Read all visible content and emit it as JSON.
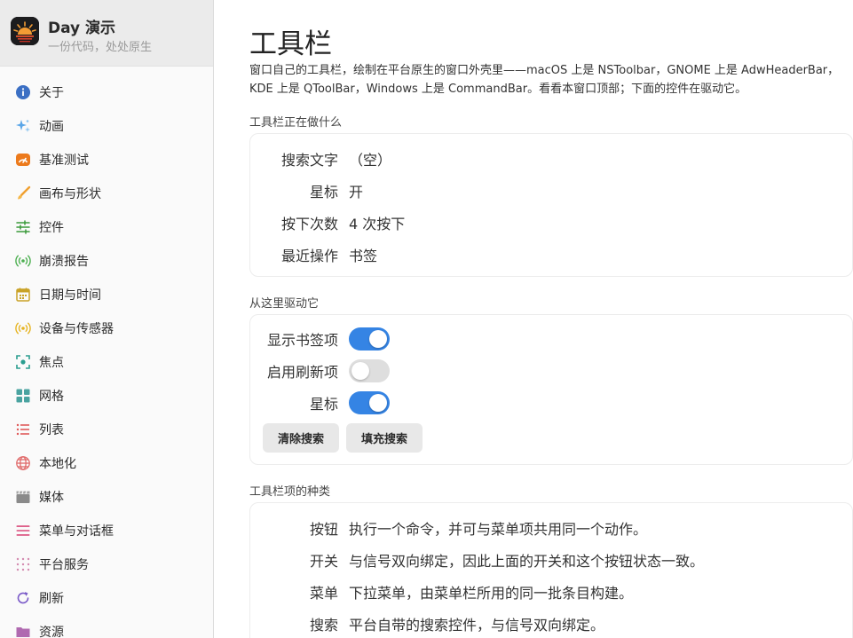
{
  "sidebar": {
    "app_title": "Day 演示",
    "app_subtitle": "一份代码，处处原生",
    "items": [
      {
        "label": "关于",
        "icon": "info-icon",
        "color": "#3b6fc4"
      },
      {
        "label": "动画",
        "icon": "sparkle-icon",
        "color": "#5aa6e8"
      },
      {
        "label": "基准测试",
        "icon": "speedometer-icon",
        "color": "#ec7a1c"
      },
      {
        "label": "画布与形状",
        "icon": "brush-icon",
        "color": "#f0a030"
      },
      {
        "label": "控件",
        "icon": "sliders-icon",
        "color": "#3a9a3a"
      },
      {
        "label": "崩溃报告",
        "icon": "broadcast-icon",
        "color": "#4caf50"
      },
      {
        "label": "日期与时间",
        "icon": "calendar-icon",
        "color": "#c9a227"
      },
      {
        "label": "设备与传感器",
        "icon": "sensor-icon",
        "color": "#e6b422"
      },
      {
        "label": "焦点",
        "icon": "focus-icon",
        "color": "#2a9d8f"
      },
      {
        "label": "网格",
        "icon": "grid-icon",
        "color": "#4aa3a0"
      },
      {
        "label": "列表",
        "icon": "list-icon",
        "color": "#e05a5a"
      },
      {
        "label": "本地化",
        "icon": "globe-icon",
        "color": "#e06a6a"
      },
      {
        "label": "媒体",
        "icon": "clapper-icon",
        "color": "#8a8a8a"
      },
      {
        "label": "菜单与对话框",
        "icon": "menu-icon",
        "color": "#d94a7a"
      },
      {
        "label": "平台服务",
        "icon": "dots-grid-icon",
        "color": "#d48ab0"
      },
      {
        "label": "刷新",
        "icon": "refresh-icon",
        "color": "#7a5ac8"
      },
      {
        "label": "资源",
        "icon": "folder-icon",
        "color": "#b06ab0"
      }
    ]
  },
  "main": {
    "title": "工具栏",
    "description": "窗口自己的工具栏，绘制在平台原生的窗口外壳里——macOS 上是 NSToolbar，GNOME 上是 AdwHeaderBar，KDE 上是 QToolBar，Windows 上是 CommandBar。看看本窗口顶部；下面的控件在驱动它。",
    "status_section": {
      "title": "工具栏正在做什么",
      "rows": [
        {
          "key": "搜索文字",
          "value": "（空）"
        },
        {
          "key": "星标",
          "value": "开"
        },
        {
          "key": "按下次数",
          "value": "4 次按下"
        },
        {
          "key": "最近操作",
          "value": "书签"
        }
      ]
    },
    "drive_section": {
      "title": "从这里驱动它",
      "toggles": [
        {
          "label": "显示书签项",
          "on": true
        },
        {
          "label": "启用刷新项",
          "on": false
        },
        {
          "label": "星标",
          "on": true
        }
      ],
      "buttons": {
        "clear": "清除搜索",
        "fill": "填充搜索"
      }
    },
    "kinds_section": {
      "title": "工具栏项的种类",
      "rows": [
        {
          "key": "按钮",
          "value": "执行一个命令，并可与菜单项共用同一个动作。"
        },
        {
          "key": "开关",
          "value": "与信号双向绑定，因此上面的开关和这个按钮状态一致。"
        },
        {
          "key": "菜单",
          "value": "下拉菜单，由菜单栏所用的同一批条目构建。"
        },
        {
          "key": "搜索",
          "value": "平台自带的搜索控件，与信号双向绑定。"
        }
      ]
    }
  },
  "colors": {
    "accent": "#3584e4",
    "toggle_off": "#dedede",
    "button_bg": "#e8e8e8"
  }
}
